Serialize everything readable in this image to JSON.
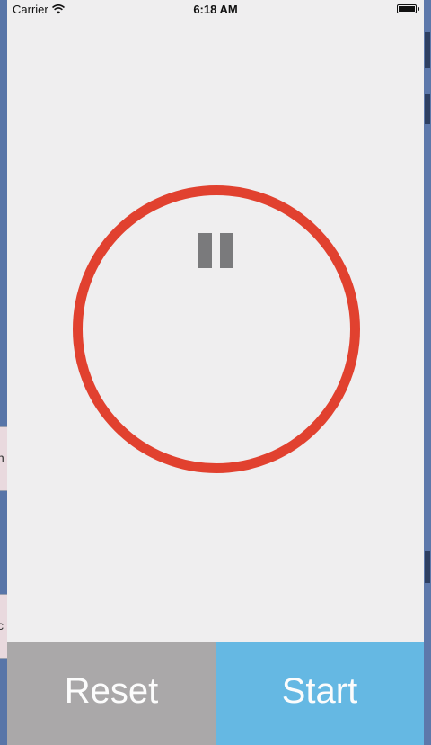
{
  "status_bar": {
    "carrier": "Carrier",
    "time": "6:18 AM",
    "wifi_icon": "wifi-icon",
    "battery_icon": "battery-icon"
  },
  "timer": {
    "ring_color": "#e1412f",
    "state_icon": "pause-icon"
  },
  "controls": {
    "reset_label": "Reset",
    "start_label": "Start",
    "reset_color": "#aaa8a9",
    "start_color": "#65b8e3"
  },
  "background": {
    "left_tab_glyphs": [
      "n",
      "c"
    ]
  }
}
